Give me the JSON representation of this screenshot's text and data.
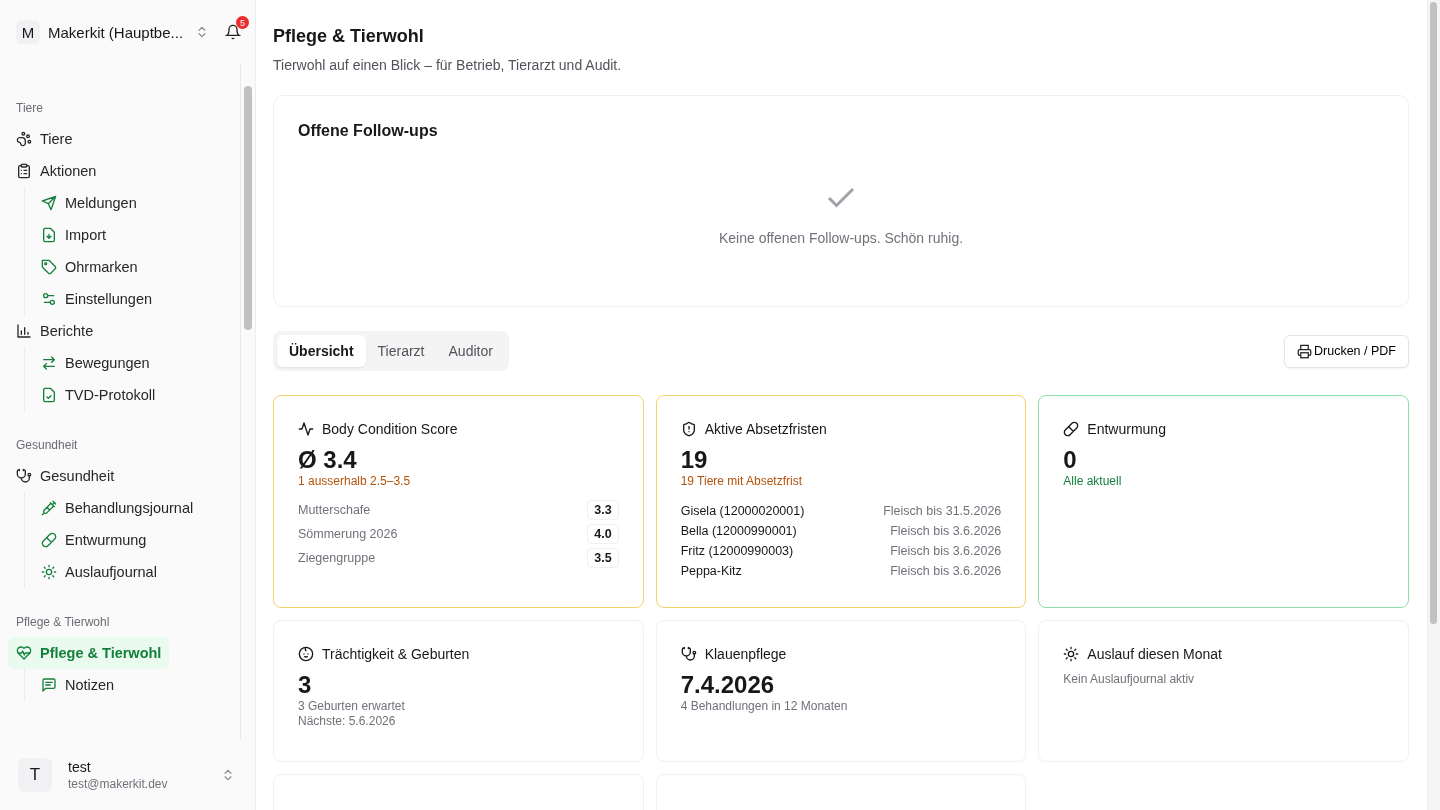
{
  "sidebar": {
    "account": {
      "initial": "M",
      "name": "Makerkit (Hauptbe...",
      "notifications": "5"
    },
    "sections": [
      {
        "label": "Tiere",
        "items": [
          {
            "label": "Tiere",
            "selected": false
          },
          {
            "label": "Aktionen",
            "selected": false,
            "children": [
              {
                "label": "Meldungen",
                "selected": false
              },
              {
                "label": "Import",
                "selected": false
              },
              {
                "label": "Ohrmarken",
                "selected": false
              },
              {
                "label": "Einstellungen",
                "selected": false
              }
            ]
          },
          {
            "label": "Berichte",
            "selected": false,
            "children": [
              {
                "label": "Bewegungen",
                "selected": false
              },
              {
                "label": "TVD-Protokoll",
                "selected": false
              }
            ]
          }
        ]
      },
      {
        "label": "Gesundheit",
        "items": [
          {
            "label": "Gesundheit",
            "selected": false,
            "children": [
              {
                "label": "Behandlungsjournal",
                "selected": false
              },
              {
                "label": "Entwurmung",
                "selected": false
              },
              {
                "label": "Auslaufjournal",
                "selected": false
              }
            ]
          }
        ]
      },
      {
        "label": "Pflege & Tierwohl",
        "items": [
          {
            "label": "Pflege & Tierwohl",
            "selected": true,
            "children": [
              {
                "label": "Notizen",
                "selected": false
              }
            ]
          }
        ]
      }
    ],
    "user": {
      "initial": "T",
      "name": "test",
      "email": "test@makerkit.dev"
    }
  },
  "page": {
    "title": "Pflege & Tierwohl",
    "subtitle": "Tierwohl auf einen Blick – für Betrieb, Tierarzt und Audit."
  },
  "followups": {
    "title": "Offene Follow-ups",
    "empty_message": "Keine offenen Follow-ups. Schön ruhig."
  },
  "tabs": [
    {
      "label": "Übersicht",
      "selected": true
    },
    {
      "label": "Tierarzt",
      "selected": false
    },
    {
      "label": "Auditor",
      "selected": false
    }
  ],
  "print_button": "Drucken / PDF",
  "cards": [
    {
      "kind": "scores",
      "color": "#f2d36b",
      "title": "Body Condition Score",
      "value": "Ø 3.4",
      "notes": [
        {
          "text": "1 ausserhalb 2.5–3.5",
          "color": "#b45309"
        }
      ],
      "rows": [
        {
          "label": "Mutterschafe",
          "value": "3.3"
        },
        {
          "label": "Sömmerung 2026",
          "value": "4.0"
        },
        {
          "label": "Ziegengruppe",
          "value": "3.5"
        }
      ]
    },
    {
      "kind": "list",
      "color": "#f2d36b",
      "title": "Aktive Absetzfristen",
      "value": "19",
      "notes": [
        {
          "text": "19 Tiere mit Absetzfrist",
          "color": "#b45309"
        }
      ],
      "rows": [
        {
          "label": "Gisela (12000020001)",
          "value": "Fleisch bis 31.5.2026"
        },
        {
          "label": "Bella (12000990001)",
          "value": "Fleisch bis 3.6.2026"
        },
        {
          "label": "Fritz (12000990003)",
          "value": "Fleisch bis 3.6.2026"
        },
        {
          "label": "Peppa-Kitz",
          "value": "Fleisch bis 3.6.2026"
        }
      ]
    },
    {
      "kind": "plain",
      "color": "#8ee0a9",
      "title": "Entwurmung",
      "value": "0",
      "notes": [
        {
          "text": "Alle aktuell",
          "color": "#15803d"
        }
      ]
    },
    {
      "kind": "plain",
      "title": "Trächtigkeit & Geburten",
      "value": "3",
      "notes": [
        {
          "text": "3 Geburten erwartet"
        },
        {
          "text": "Nächste: 5.6.2026"
        }
      ]
    },
    {
      "kind": "plain",
      "title": "Klauenpflege",
      "value": "7.4.2026",
      "notes": [
        {
          "text": "4 Behandlungen in 12 Monaten"
        }
      ]
    },
    {
      "kind": "plain",
      "title": "Auslauf diesen Monat",
      "notes": [
        {
          "text": "Kein Auslaufjournal aktiv"
        }
      ]
    },
    {
      "kind": "blank"
    },
    {
      "kind": "blank"
    }
  ]
}
